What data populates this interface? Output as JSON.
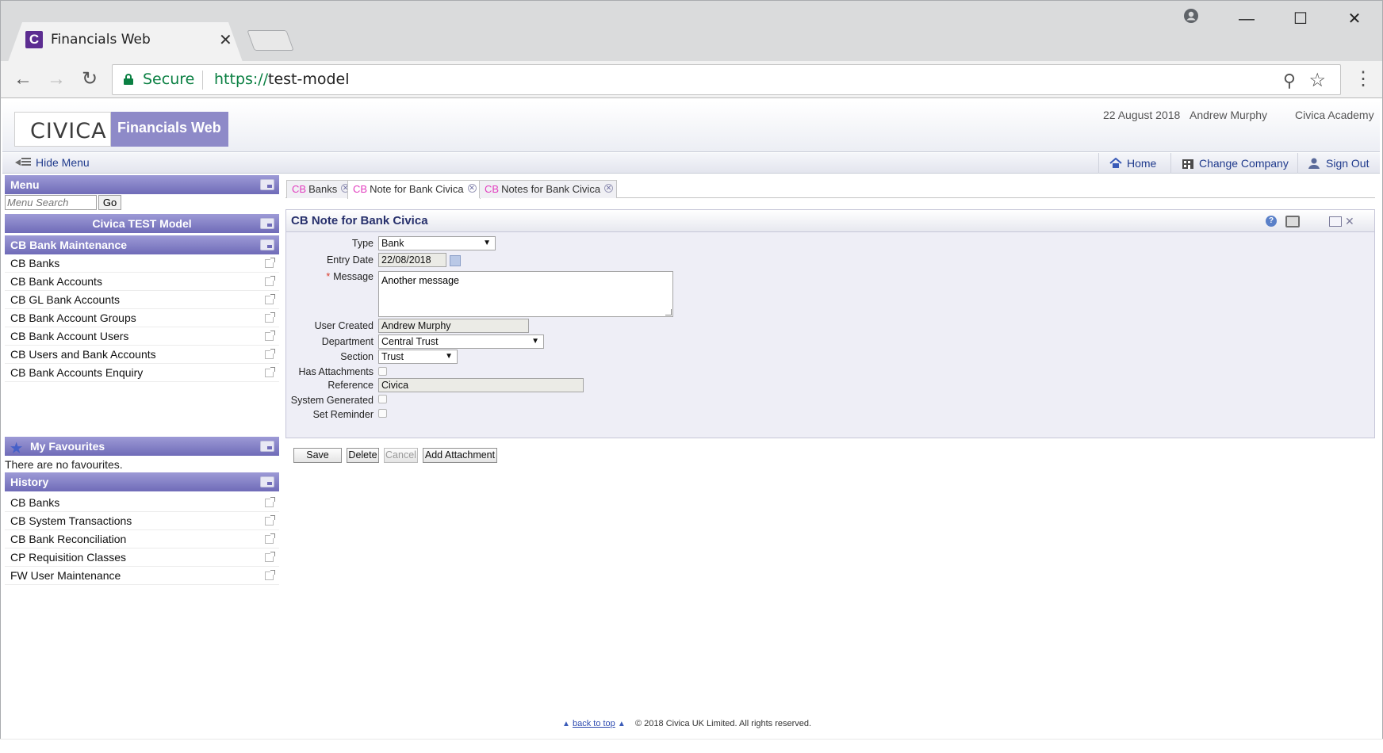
{
  "browser": {
    "tab_title": "Financials Web",
    "tab_favicon_letter": "C",
    "secure_label": "Secure",
    "url_scheme": "https://",
    "url_host": "test-model",
    "icons": [
      "back-icon",
      "forward-icon",
      "reload-icon",
      "lock-icon",
      "zoom-icon",
      "star-icon",
      "menu-icon",
      "account-icon",
      "minimize-icon",
      "maximize-icon",
      "close-icon"
    ]
  },
  "header": {
    "logo": "CIVICA",
    "product": "Financials Web",
    "date": "22 August 2018",
    "user": "Andrew Murphy",
    "company": "Civica Academy"
  },
  "navbar": {
    "hide_menu": "Hide Menu",
    "home": "Home",
    "change_company": "Change Company",
    "sign_out": "Sign Out"
  },
  "sidebar": {
    "menu_title": "Menu",
    "search_placeholder": "Menu Search",
    "go_label": "Go",
    "model_title": "Civica TEST Model",
    "section_title": "CB Bank Maintenance",
    "items": [
      {
        "label": "CB Banks"
      },
      {
        "label": "CB Bank Accounts"
      },
      {
        "label": "CB GL Bank Accounts"
      },
      {
        "label": "CB Bank Account Groups"
      },
      {
        "label": "CB Bank Account Users"
      },
      {
        "label": "CB Users and Bank Accounts"
      },
      {
        "label": "CB Bank Accounts Enquiry"
      }
    ],
    "favourites_title": "My Favourites",
    "favourites_empty": "There are no favourites.",
    "history_title": "History",
    "history": [
      {
        "label": "CB Banks"
      },
      {
        "label": "CB System Transactions"
      },
      {
        "label": "CB Bank Reconciliation"
      },
      {
        "label": "CP Requisition Classes"
      },
      {
        "label": "FW User Maintenance"
      }
    ]
  },
  "tabs": [
    {
      "module": "CB",
      "label": "Banks"
    },
    {
      "module": "CB",
      "label": "Note for Bank Civica"
    },
    {
      "module": "CB",
      "label": "Notes for Bank Civica"
    }
  ],
  "form": {
    "title": "CB Note for Bank Civica",
    "fields": {
      "type": {
        "label": "Type",
        "value": "Bank"
      },
      "entry_date": {
        "label": "Entry Date",
        "value": "22/08/2018"
      },
      "message": {
        "label": "Message",
        "value": "Another message",
        "required_marker": "*"
      },
      "user_created": {
        "label": "User Created",
        "value": "Andrew Murphy"
      },
      "department": {
        "label": "Department",
        "value": "Central Trust"
      },
      "section": {
        "label": "Section",
        "value": "Trust"
      },
      "has_attachments": {
        "label": "Has Attachments",
        "checked": false
      },
      "reference": {
        "label": "Reference",
        "value": "Civica"
      },
      "system_generated": {
        "label": "System Generated",
        "checked": false
      },
      "set_reminder": {
        "label": "Set Reminder",
        "checked": false
      }
    }
  },
  "buttons": {
    "save": "Save",
    "delete": "Delete",
    "cancel": "Cancel",
    "add_attachment": "Add Attachment"
  },
  "footer": {
    "back_to_top": "back to top",
    "copyright": "© 2018 Civica UK Limited. All rights reserved."
  },
  "colors": {
    "accent_purple": "#6f6bb8",
    "product_box": "#8e8ac8",
    "secure_green": "#0b8043",
    "module_pink": "#e23dbf",
    "link_blue": "#1f3a8c"
  }
}
